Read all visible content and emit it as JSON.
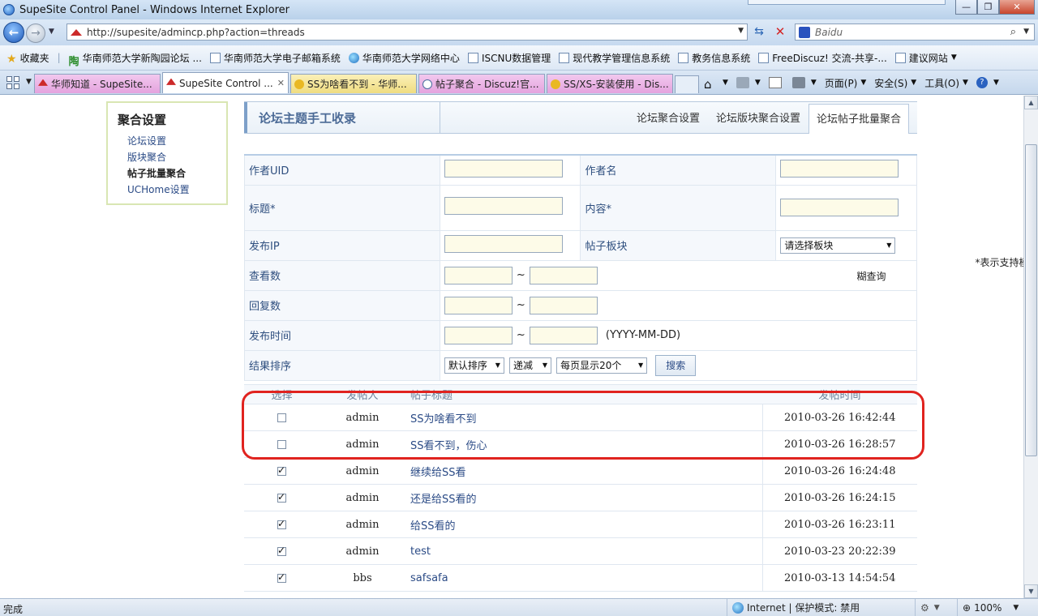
{
  "window": {
    "title": "SupeSite Control Panel - Windows Internet Explorer",
    "minimize": "—",
    "maximize": "❐",
    "close": "✕"
  },
  "address": {
    "url": "http://supesite/admincp.php?action=threads",
    "search_placeholder": "Baidu"
  },
  "favorites": {
    "label": "收藏夹",
    "items": [
      "华南师范大学新陶园论坛 ...",
      "华南师范大学电子邮箱系统",
      "华南师范大学网络中心",
      "ISCNU数据管理",
      "现代教学管理信息系统",
      "教务信息系统",
      "FreeDiscuz! 交流-共享-...",
      "建议网站"
    ]
  },
  "tabs": [
    {
      "label": "华师知道 - SupeSite..."
    },
    {
      "label": "SupeSite Control ..."
    },
    {
      "label": "SS为啥看不到 - 华师..."
    },
    {
      "label": "帖子聚合 - Discuz!官..."
    },
    {
      "label": "SS/XS-安装使用 - Dis..."
    }
  ],
  "commands": {
    "page": "页面(P)",
    "safety": "安全(S)",
    "tools": "工具(O)"
  },
  "sidebar": {
    "title": "聚合设置",
    "items": [
      {
        "label": "论坛设置"
      },
      {
        "label": "版块聚合"
      },
      {
        "label": "帖子批量聚合"
      },
      {
        "label": "UCHome设置"
      }
    ]
  },
  "header": {
    "title": "论坛主题手工收录",
    "tabs": [
      {
        "label": "论坛聚合设置"
      },
      {
        "label": "论坛版块聚合设置"
      },
      {
        "label": "论坛帖子批量聚合"
      }
    ]
  },
  "form": {
    "author_uid": "作者UID",
    "author_name": "作者名",
    "title": "标题*",
    "content": "内容*",
    "fuzzy_hint": "*表示支持模糊查询",
    "post_ip": "发布IP",
    "board": "帖子板块",
    "board_select": "请选择板块",
    "views": "查看数",
    "replies": "回复数",
    "post_time": "发布时间",
    "tilde": "~",
    "date_format": "(YYYY-MM-DD)",
    "sort": "结果排序",
    "sort_default": "默认排序",
    "sort_order": "递减",
    "page_size": "每页显示20个",
    "search_button": "搜索"
  },
  "results": {
    "headers": {
      "select": "选择",
      "author": "发帖人",
      "title": "帖子标题",
      "time": "发帖时间"
    },
    "rows": [
      {
        "checked": false,
        "author": "admin",
        "title": "SS为啥看不到",
        "time": "2010-03-26 16:42:44"
      },
      {
        "checked": false,
        "author": "admin",
        "title": "SS看不到，伤心",
        "time": "2010-03-26 16:28:57"
      },
      {
        "checked": true,
        "author": "admin",
        "title": "继续给SS看",
        "time": "2010-03-26 16:24:48"
      },
      {
        "checked": true,
        "author": "admin",
        "title": "还是给SS看的",
        "time": "2010-03-26 16:24:15"
      },
      {
        "checked": true,
        "author": "admin",
        "title": "给SS看的",
        "time": "2010-03-26 16:23:11"
      },
      {
        "checked": true,
        "author": "admin",
        "title": "test",
        "time": "2010-03-23 20:22:39"
      },
      {
        "checked": true,
        "author": "bbs",
        "title": "safsafa",
        "time": "2010-03-13 14:54:54"
      }
    ]
  },
  "status": {
    "left": "完成",
    "zone": "Internet | 保护模式: 禁用",
    "zoom": "100%"
  },
  "colors": {
    "highlight": "#e0231f",
    "link": "#2b4b86"
  }
}
